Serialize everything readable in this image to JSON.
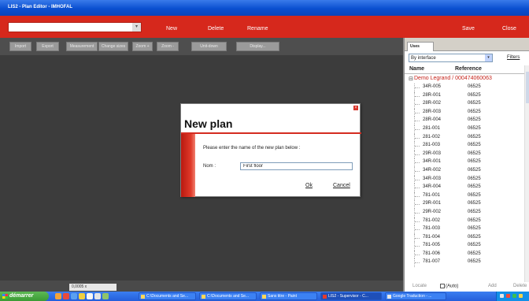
{
  "window": {
    "title": "LIS2 - Plan Editor - IMHOFAL"
  },
  "menubar": {
    "plan_select_value": "",
    "new_label": "New",
    "delete_label": "Delete",
    "rename_label": "Rename",
    "save_label": "Save",
    "close_label": "Close"
  },
  "toolbar": {
    "buttons": [
      "Import",
      "Export",
      "Measurement",
      "Change sizes",
      "Zoom +",
      "Zoom -",
      "Unit-down",
      "Display..."
    ]
  },
  "status": {
    "zoom": "0,0005 x"
  },
  "panel": {
    "tab_label": "Uses",
    "filter_value": "By interface",
    "filters_link": "Filters",
    "columns": {
      "name": "Name",
      "reference": "Reference"
    },
    "group_label": "Demo Legrand / 000474060063",
    "rows": [
      {
        "name": "34R-005",
        "ref": "06525"
      },
      {
        "name": "28R-001",
        "ref": "06525"
      },
      {
        "name": "28R-002",
        "ref": "06525"
      },
      {
        "name": "28R-003",
        "ref": "06525"
      },
      {
        "name": "28R-004",
        "ref": "06525"
      },
      {
        "name": "281-001",
        "ref": "06525"
      },
      {
        "name": "281-002",
        "ref": "06525"
      },
      {
        "name": "281-003",
        "ref": "06525"
      },
      {
        "name": "29R-003",
        "ref": "06525"
      },
      {
        "name": "34R-001",
        "ref": "06525"
      },
      {
        "name": "34R-002",
        "ref": "06525"
      },
      {
        "name": "34R-003",
        "ref": "06525"
      },
      {
        "name": "34R-004",
        "ref": "06525"
      },
      {
        "name": "781-001",
        "ref": "06525"
      },
      {
        "name": "29R-001",
        "ref": "06525"
      },
      {
        "name": "29R-002",
        "ref": "06525"
      },
      {
        "name": "781-002",
        "ref": "06525"
      },
      {
        "name": "781-003",
        "ref": "06525"
      },
      {
        "name": "781-004",
        "ref": "06525"
      },
      {
        "name": "781-005",
        "ref": "06525"
      },
      {
        "name": "781-006",
        "ref": "06525"
      },
      {
        "name": "781-007",
        "ref": "06525"
      }
    ],
    "bottom": {
      "locate": "Locate",
      "auto": "(Auto)",
      "add": "Add",
      "delete": "Delete"
    }
  },
  "dialog": {
    "title": "New plan",
    "message": "Please enter the name of the new plan below :",
    "name_label": "Nom :",
    "name_value": "First floor",
    "ok_label": "Ok",
    "cancel_label": "Cancel"
  },
  "taskbar": {
    "start_label": "démarrer",
    "tasks": [
      "C:\\Documents and Se...",
      "C:\\Documents and Se...",
      "Sans titre - Paint",
      "LIS2 - Supervisor - C...",
      "Google Traduction - ..."
    ]
  },
  "colors": {
    "accent_red": "#d6281c",
    "canvas": "#3c3c3c",
    "xp_blue": "#245edb"
  }
}
